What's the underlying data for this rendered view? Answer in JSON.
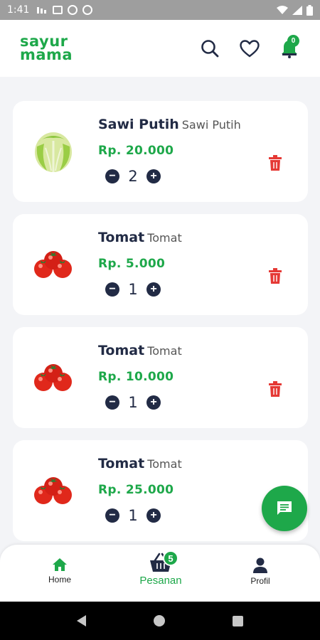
{
  "status_bar": {
    "time": "1:41"
  },
  "header": {
    "logo_line1": "sayur",
    "logo_line2": "mama",
    "cart_badge": "0"
  },
  "items": [
    {
      "name": "Sawi Putih",
      "subname": "Sawi Putih",
      "price": "Rp. 20.000",
      "qty": "2",
      "image": "cabbage-image"
    },
    {
      "name": "Tomat",
      "subname": "Tomat",
      "price": "Rp. 5.000",
      "qty": "1",
      "image": "tomato-image"
    },
    {
      "name": "Tomat",
      "subname": "Tomat",
      "price": "Rp. 10.000",
      "qty": "1",
      "image": "tomato-image"
    },
    {
      "name": "Tomat",
      "subname": "Tomat",
      "price": "Rp. 25.000",
      "qty": "1",
      "image": "tomato-image"
    }
  ],
  "bottom_nav": {
    "home_label": "Home",
    "pesanan_label": "Pesanan",
    "pesanan_badge": "5",
    "profil_label": "Profil"
  },
  "colors": {
    "brand_green": "#1ea84a",
    "dark_navy": "#222b45",
    "delete_red": "#e53935"
  }
}
